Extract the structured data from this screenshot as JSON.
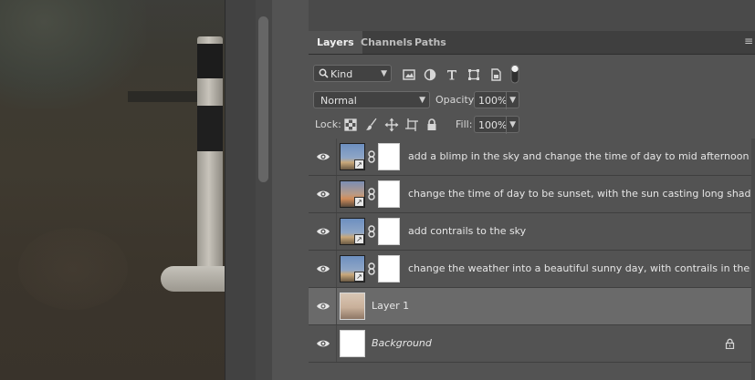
{
  "panel": {
    "tabs": [
      {
        "label": "Layers",
        "active": true
      },
      {
        "label": "Channels",
        "active": false
      },
      {
        "label": "Paths",
        "active": false
      }
    ],
    "menu_icon": "hamburger-icon"
  },
  "filter": {
    "kind_label": "Kind",
    "icons": [
      "image-filter-icon",
      "adjustment-filter-icon",
      "type-filter-icon",
      "shape-filter-icon",
      "smartobject-filter-icon",
      "filter-toggle-icon"
    ]
  },
  "blend": {
    "mode": "Normal",
    "opacity_label": "Opacity:",
    "opacity_value": "100%"
  },
  "lock": {
    "label": "Lock:",
    "icons": [
      "lock-transparent-icon",
      "lock-image-icon",
      "lock-position-icon",
      "lock-artboard-icon",
      "lock-all-icon"
    ],
    "fill_label": "Fill:",
    "fill_value": "100%"
  },
  "layers": [
    {
      "name": "add a blimp in the sky and change the time of day to mid afternoon",
      "thumb": "sky",
      "smart": true,
      "mask": true,
      "selected": false,
      "italic": false,
      "locked": false
    },
    {
      "name": "change the time of day to be sunset, with the sun casting long shadows",
      "thumb": "sunset",
      "smart": true,
      "mask": true,
      "selected": false,
      "italic": false,
      "locked": false
    },
    {
      "name": "add contrails to the sky",
      "thumb": "sky",
      "smart": true,
      "mask": true,
      "selected": false,
      "italic": false,
      "locked": false
    },
    {
      "name": "change the weather into a beautiful sunny day, with contrails in the sky",
      "thumb": "sky",
      "smart": true,
      "mask": true,
      "selected": false,
      "italic": false,
      "locked": false
    },
    {
      "name": "Layer 1",
      "thumb": "layer1",
      "smart": false,
      "mask": false,
      "selected": true,
      "italic": false,
      "locked": false
    },
    {
      "name": "Background",
      "thumb": "white",
      "smart": false,
      "mask": false,
      "selected": false,
      "italic": true,
      "locked": true
    }
  ],
  "colors": {
    "panel_bg": "#535353",
    "selected_row": "#6a6a6a",
    "tab_bar": "#3f3f3f"
  }
}
